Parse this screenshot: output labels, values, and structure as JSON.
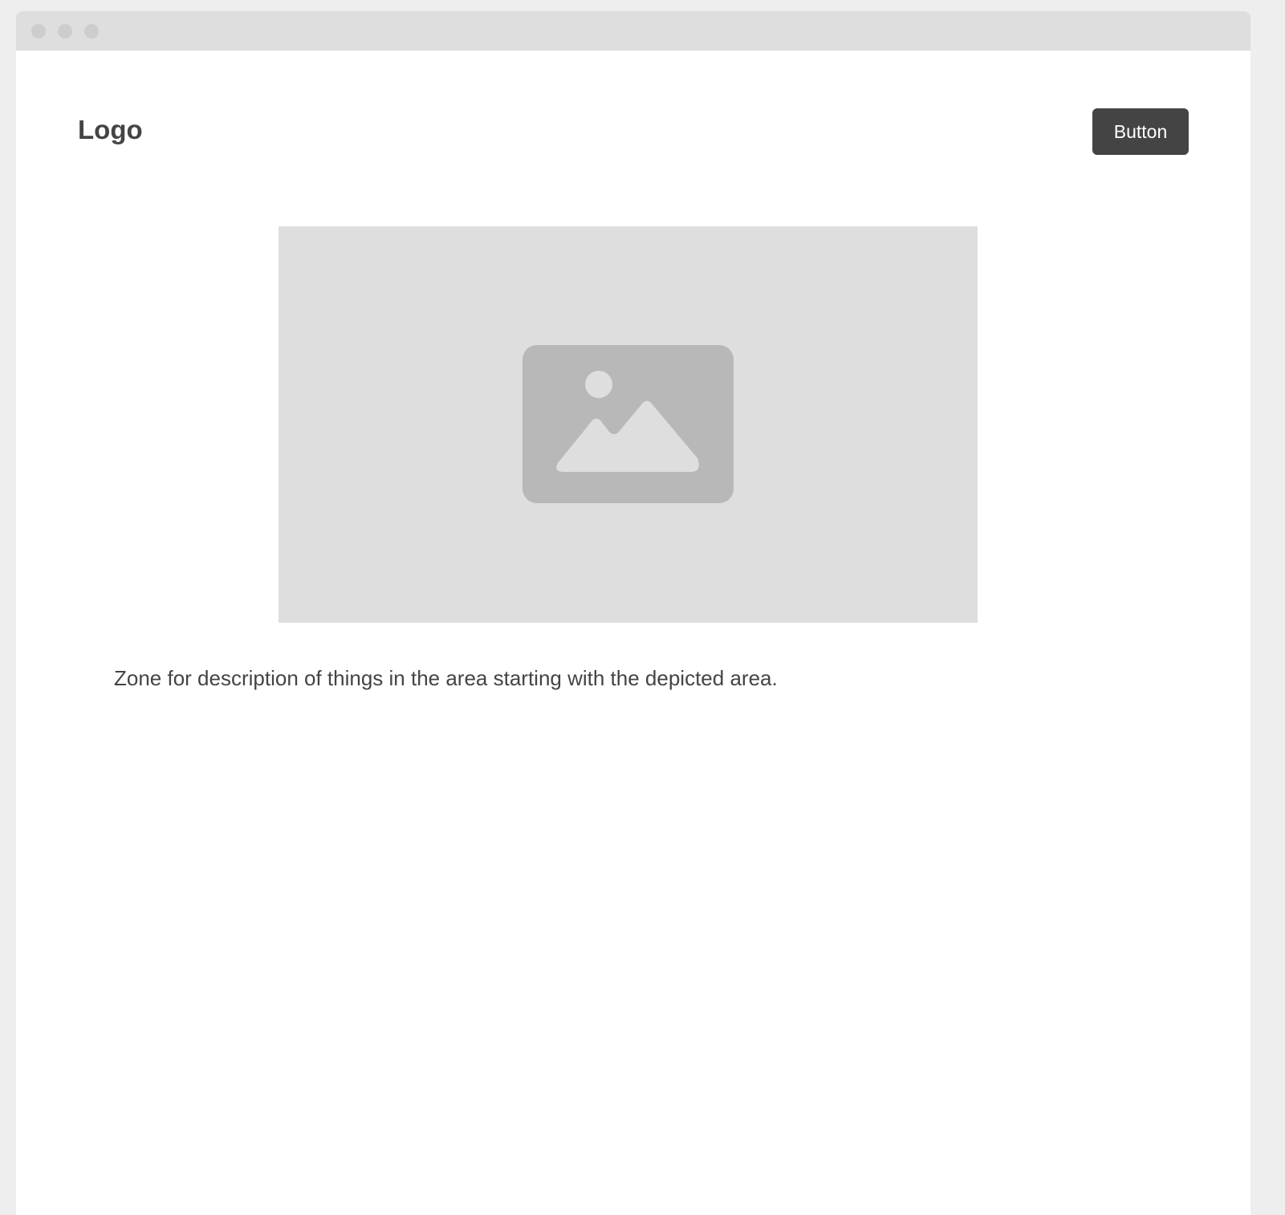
{
  "header": {
    "logo_text": "Logo",
    "button_label": "Button"
  },
  "main": {
    "image": {
      "icon": "image-placeholder-icon"
    },
    "description": "Zone for description of things in the area starting with the depicted area."
  },
  "colors": {
    "page_background": "#eeeeee",
    "titlebar": "#dedede",
    "window_dots": "#cdcdcd",
    "text": "#444444",
    "button_background": "#444444",
    "button_text": "#ffffff",
    "image_placeholder": "#dedede",
    "image_icon": "#b8b8b8"
  }
}
